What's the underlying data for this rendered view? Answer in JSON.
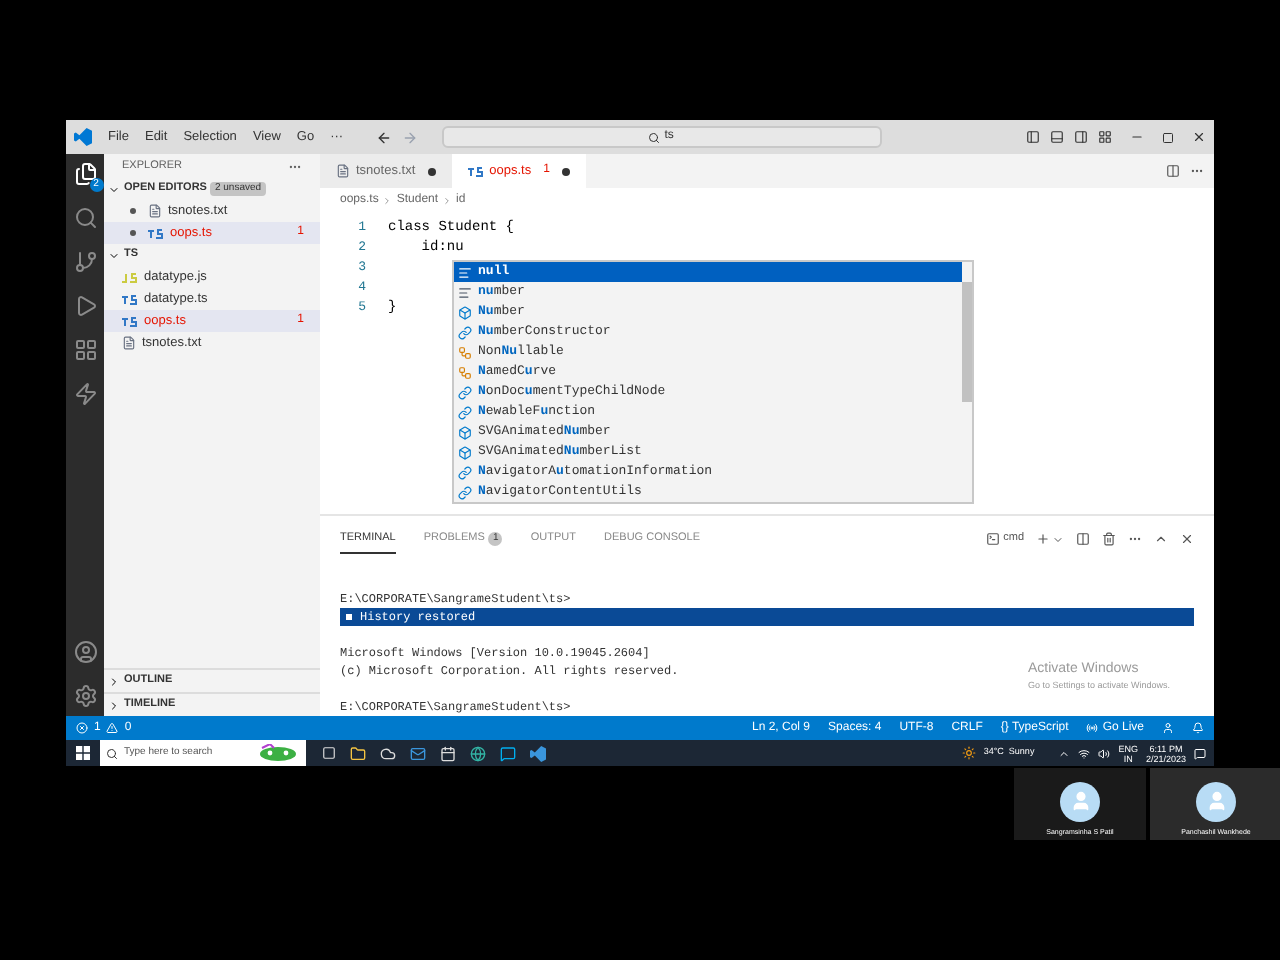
{
  "title_bar": {
    "menu": [
      "File",
      "Edit",
      "Selection",
      "View",
      "Go",
      "···"
    ],
    "search": "ts"
  },
  "activity_bar": {
    "explorer_badge": "2"
  },
  "explorer": {
    "title": "EXPLORER",
    "open_editors": {
      "label": "OPEN EDITORS",
      "badge": "2 unsaved",
      "expanded": true,
      "items": [
        {
          "name": "tsnotes.txt",
          "kind": "txt",
          "selected": false
        },
        {
          "name": "oops.ts",
          "kind": "ts",
          "selected": true,
          "problems": "1"
        }
      ]
    },
    "folder": {
      "label": "TS",
      "expanded": true,
      "items": [
        {
          "name": "datatype.js",
          "kind": "js",
          "selected": false
        },
        {
          "name": "datatype.ts",
          "kind": "ts",
          "selected": false
        },
        {
          "name": "oops.ts",
          "kind": "ts",
          "selected": true,
          "problems": "1"
        },
        {
          "name": "tsnotes.txt",
          "kind": "txt",
          "selected": false
        }
      ]
    },
    "bottom_sections": [
      {
        "label": "OUTLINE",
        "expanded": false
      },
      {
        "label": "TIMELINE",
        "expanded": false
      }
    ]
  },
  "tabs": [
    {
      "name": "tsnotes.txt",
      "kind": "txt",
      "selected": false,
      "unsaved": true
    },
    {
      "name": "oops.ts",
      "kind": "ts",
      "selected": true,
      "problems": "1",
      "unsaved": true
    }
  ],
  "breadcrumb": [
    "oops.ts",
    "Student",
    "id"
  ],
  "code_lines": [
    {
      "number": "1",
      "text": "class Student {"
    },
    {
      "number": "2",
      "text": "    id:nu"
    },
    {
      "number": "3"
    },
    {
      "number": "4"
    },
    {
      "number": "5",
      "text": "}"
    }
  ],
  "suggestions": [
    {
      "label": "**nu**ll",
      "kind": "keyword",
      "selected": true
    },
    {
      "label": "**nu**mber",
      "kind": "keyword",
      "selected": false
    },
    {
      "label": "**Nu**mber",
      "kind": "variable",
      "selected": false
    },
    {
      "label": "**Nu**mberConstructor",
      "kind": "interface",
      "selected": false
    },
    {
      "label": "Non**Nu**llable",
      "kind": "class",
      "selected": false
    },
    {
      "label": "**N**amedC**u**rve",
      "kind": "class",
      "selected": false
    },
    {
      "label": "**N**onDoc**u**mentTypeChildNode",
      "kind": "interface",
      "selected": false
    },
    {
      "label": "**N**ewableF**u**nction",
      "kind": "interface",
      "selected": false
    },
    {
      "label": "SVGAnimated**Nu**mber",
      "kind": "variable",
      "selected": false
    },
    {
      "label": "SVGAnimated**Nu**mberList",
      "kind": "variable",
      "selected": false
    },
    {
      "label": "**N**avigatorA**u**tomationInformation",
      "kind": "interface",
      "selected": false
    },
    {
      "label": "**N**avigatorContentUtils",
      "kind": "interface",
      "selected": false
    }
  ],
  "panel": {
    "tabs": [
      {
        "label": "TERMINAL",
        "selected": true
      },
      {
        "label": "PROBLEMS",
        "badge": "1",
        "selected": false
      },
      {
        "label": "OUTPUT",
        "selected": false
      },
      {
        "label": "DEBUG CONSOLE",
        "selected": false
      }
    ],
    "shell": "cmd",
    "terminal_lines": [
      {
        "kind": "text",
        "text": "E:\\CORPORATE\\SangrameStudent\\ts>"
      },
      {
        "kind": "notice",
        "text": "History restored"
      },
      {
        "kind": "blank"
      },
      {
        "kind": "text",
        "text": "Microsoft Windows [Version 10.0.19045.2604]"
      },
      {
        "kind": "text",
        "text": "(c) Microsoft Corporation. All rights reserved."
      },
      {
        "kind": "blank"
      },
      {
        "kind": "text",
        "text": "E:\\CORPORATE\\SangrameStudent\\ts>"
      }
    ]
  },
  "activation_notice": {
    "title": "Activate Windows",
    "text": "Go to Settings to activate Windows."
  },
  "status_bar": {
    "errors": "1",
    "warnings": "0",
    "items": [
      "Ln 2, Col 9",
      "Spaces: 4",
      "UTF-8",
      "CRLF",
      "{} TypeScript"
    ],
    "go_live": "Go Live"
  },
  "taskbar": {
    "search_placeholder": "Type here to search",
    "weather": "34°C  Sunny",
    "language": "ENG",
    "region": "IN",
    "time": "6:11 PM",
    "date": "2/21/2023"
  },
  "participants": [
    {
      "name": "Sangramsinha S Patil"
    },
    {
      "name": "Panchashil Wankhede"
    }
  ]
}
